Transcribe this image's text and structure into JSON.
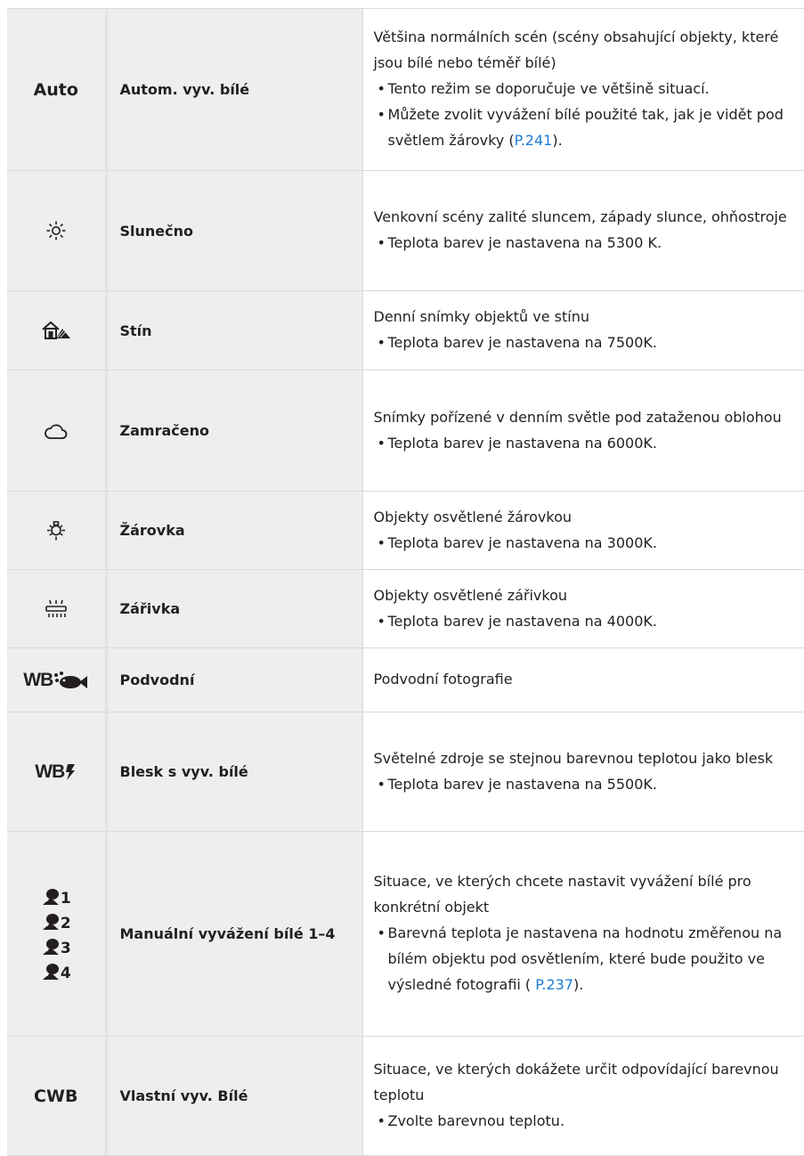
{
  "rows": [
    {
      "icon_text": "Auto",
      "name": "Autom. vyv. bílé",
      "desc": "Většina normálních scén (scény obsahující objekty, které jsou bílé nebo téměř bílé)",
      "bullets": [
        "Tento režim se doporučuje ve většině situací.",
        "Můžete zvolit vyvážení bílé použité tak, jak je vidět pod světlem žárovky ("
      ],
      "link": "P.241",
      "link_after": ")."
    },
    {
      "icon": "sun-icon",
      "name": "Slunečno",
      "desc": "Venkovní scény zalité sluncem, západy slunce, ohňostroje",
      "bullets": [
        "Teplota barev je nastavena na 5300 K."
      ]
    },
    {
      "icon": "shade-icon",
      "name": "Stín",
      "desc": "Denní snímky objektů ve stínu",
      "bullets": [
        "Teplota barev je nastavena na 7500K."
      ]
    },
    {
      "icon": "cloud-icon",
      "name": "Zamračeno",
      "desc": "Snímky pořízené v denním světle pod zataženou oblohou",
      "bullets": [
        "Teplota barev je nastavena na 6000K."
      ]
    },
    {
      "icon": "incandescent-bulb-icon",
      "name": "Žárovka",
      "desc": "Objekty osvětlené žárovkou",
      "bullets": [
        "Teplota barev je nastavena na 3000K."
      ]
    },
    {
      "icon": "fluorescent-lamp-icon",
      "name": "Zářivka",
      "desc": "Objekty osvětlené zářivkou",
      "bullets": [
        "Teplota barev je nastavena na 4000K."
      ]
    },
    {
      "icon": "underwater-wb-icon",
      "icon_text": "WB",
      "name": "Podvodní",
      "desc": "Podvodní fotografie"
    },
    {
      "icon": "flash-wb-icon",
      "icon_text": "WB",
      "name": "Blesk s vyv. bílé",
      "desc": "Světelné zdroje se stejnou barevnou teplotou jako blesk",
      "bullets": [
        "Teplota barev je nastavena na 5500K."
      ]
    },
    {
      "icon": "manual-wb-icon",
      "icon_numbers": [
        "1",
        "2",
        "3",
        "4"
      ],
      "name": "Manuální vyvážení bílé 1–4",
      "desc": "Situace, ve kterých chcete nastavit vyvážení bílé pro konkrétní objekt",
      "bullets": [
        "Barevná teplota je nastavena na hodnotu změřenou na bílém objektu pod osvětlením, které bude použito ve výsledné fotografii ( "
      ],
      "link": "P.237",
      "link_after": ")."
    },
    {
      "icon_text": "CWB",
      "name": "Vlastní vyv. Bílé",
      "desc": "Situace, ve kterých dokážete určit odpovídající barevnou teplotu",
      "bullets": [
        "Zvolte barevnou teplotu."
      ]
    }
  ],
  "colors": {
    "link": "#1a7ed6",
    "cell_bg": "#eeeeee",
    "text": "#231f20"
  }
}
